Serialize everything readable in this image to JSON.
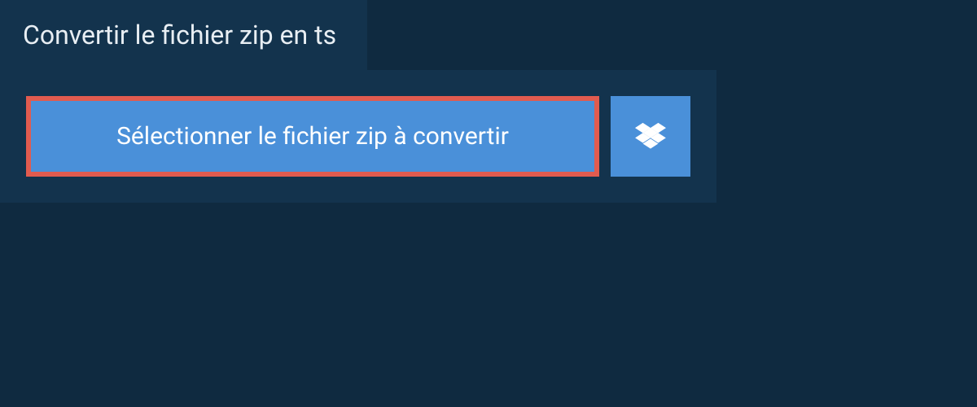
{
  "header": {
    "title": "Convertir le fichier zip en ts"
  },
  "actions": {
    "select_file_label": "Sélectionner le fichier zip à convertir"
  },
  "colors": {
    "background": "#0f2a40",
    "panel": "#13334d",
    "button": "#4a90d9",
    "highlight_border": "#e15b4f",
    "text": "#ffffff"
  }
}
